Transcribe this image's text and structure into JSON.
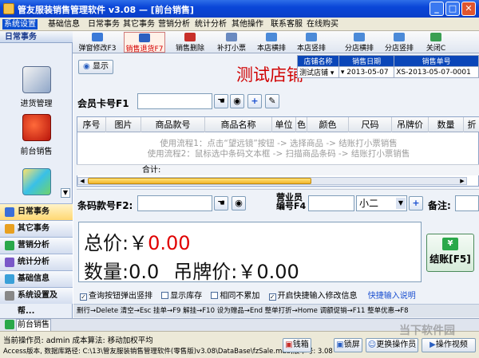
{
  "window": {
    "title": "管友服装销售管理软件 v3.08 — [前台销售]"
  },
  "menubar": [
    "系统设置",
    "基础信息",
    "日常事务",
    "其它事务",
    "营销分析",
    "统计分析",
    "其他操作",
    "联系客服",
    "在线购买"
  ],
  "left_panel": {
    "header": "日常事务",
    "items": [
      {
        "label": "进货管理"
      },
      {
        "label": "前台销售"
      }
    ],
    "nav": [
      {
        "label": "日常事务"
      },
      {
        "label": "其它事务"
      },
      {
        "label": "营销分析"
      },
      {
        "label": "统计分析"
      },
      {
        "label": "基础信息"
      },
      {
        "label": "系统设置及帮..."
      }
    ]
  },
  "toolbar": {
    "buttons": [
      {
        "label": "弹窗修改F3"
      },
      {
        "label": "销售退货F7"
      },
      {
        "label": "销售删除"
      },
      {
        "label": "补打小票"
      },
      {
        "label": "本店横排"
      },
      {
        "label": "本店竖排"
      },
      {
        "label": "分店横排"
      },
      {
        "label": "分店竖排"
      },
      {
        "label": "关闭C"
      }
    ]
  },
  "show_button": "显示",
  "store_title": "测试店铺",
  "store_table": {
    "headers": [
      "店铺名称",
      "销售日期",
      "销售单号"
    ],
    "row": [
      "测试店铺",
      "2013-05-07",
      "XS-2013-05-07-0001"
    ]
  },
  "member": {
    "label": "会员卡号F1",
    "value": ""
  },
  "grid": {
    "columns": [
      "序号",
      "图片",
      "商品款号",
      "商品名称",
      "单位",
      "色",
      "颜色",
      "尺码",
      "吊牌价",
      "数量",
      "折"
    ],
    "hint1": "使用流程1：点击“望远镜”按钮 -> 选择商品 -> 结账打小票销售",
    "hint2": "使用流程2：鼠标选中条码文本框 -> 扫描商品条码 -> 结账打小票销售",
    "total_label": "合计:"
  },
  "barcode": {
    "label": "条码款号F2:",
    "value": ""
  },
  "salesperson": {
    "label_line1": "营业员",
    "label_line2": "编号F4",
    "code": "",
    "name": "小二"
  },
  "remark": {
    "label": "备注:",
    "value": ""
  },
  "totals": {
    "price_label": "总价:",
    "currency": "￥",
    "price": "0.00",
    "qty_label": "数量:",
    "qty": "0.0",
    "tag_label": "吊牌价:",
    "tag_price": "￥0.00"
  },
  "checkout": {
    "label": "结账[F5]"
  },
  "options": [
    {
      "label": "查询按钮弹出竖排",
      "checked": true
    },
    {
      "label": "显示库存",
      "checked": false
    },
    {
      "label": "相同不累加",
      "checked": false
    },
    {
      "label": "开启快捷输入修改信息",
      "checked": true
    }
  ],
  "quick_input_link": "快捷输入说明",
  "shortcuts": "删行→Delete 清空→Esc  挂单→F9 解挂→F10  设为赠品→End 整单打折→Home 调额促销→F11 整单优惠→F8",
  "tab": "前台销售",
  "status": {
    "line1": "当前操作员: admin  成本算法: 移动加权平均",
    "line2": "Access版本, 数据库路径: C:\\13\\管友服装销售管理软件(零售版)v3.08\\DataBase\\fzSale.mdb,版本号: 3.08",
    "buttons": [
      "钱箱",
      "锁屏",
      "更换操作员",
      "操作视频"
    ]
  },
  "watermark": "当下软件园",
  "colors": {
    "title_blue": "#0a46d8",
    "store_red": "#d00000",
    "price_red": "#e00000",
    "accent_green": "#2aa84a"
  }
}
